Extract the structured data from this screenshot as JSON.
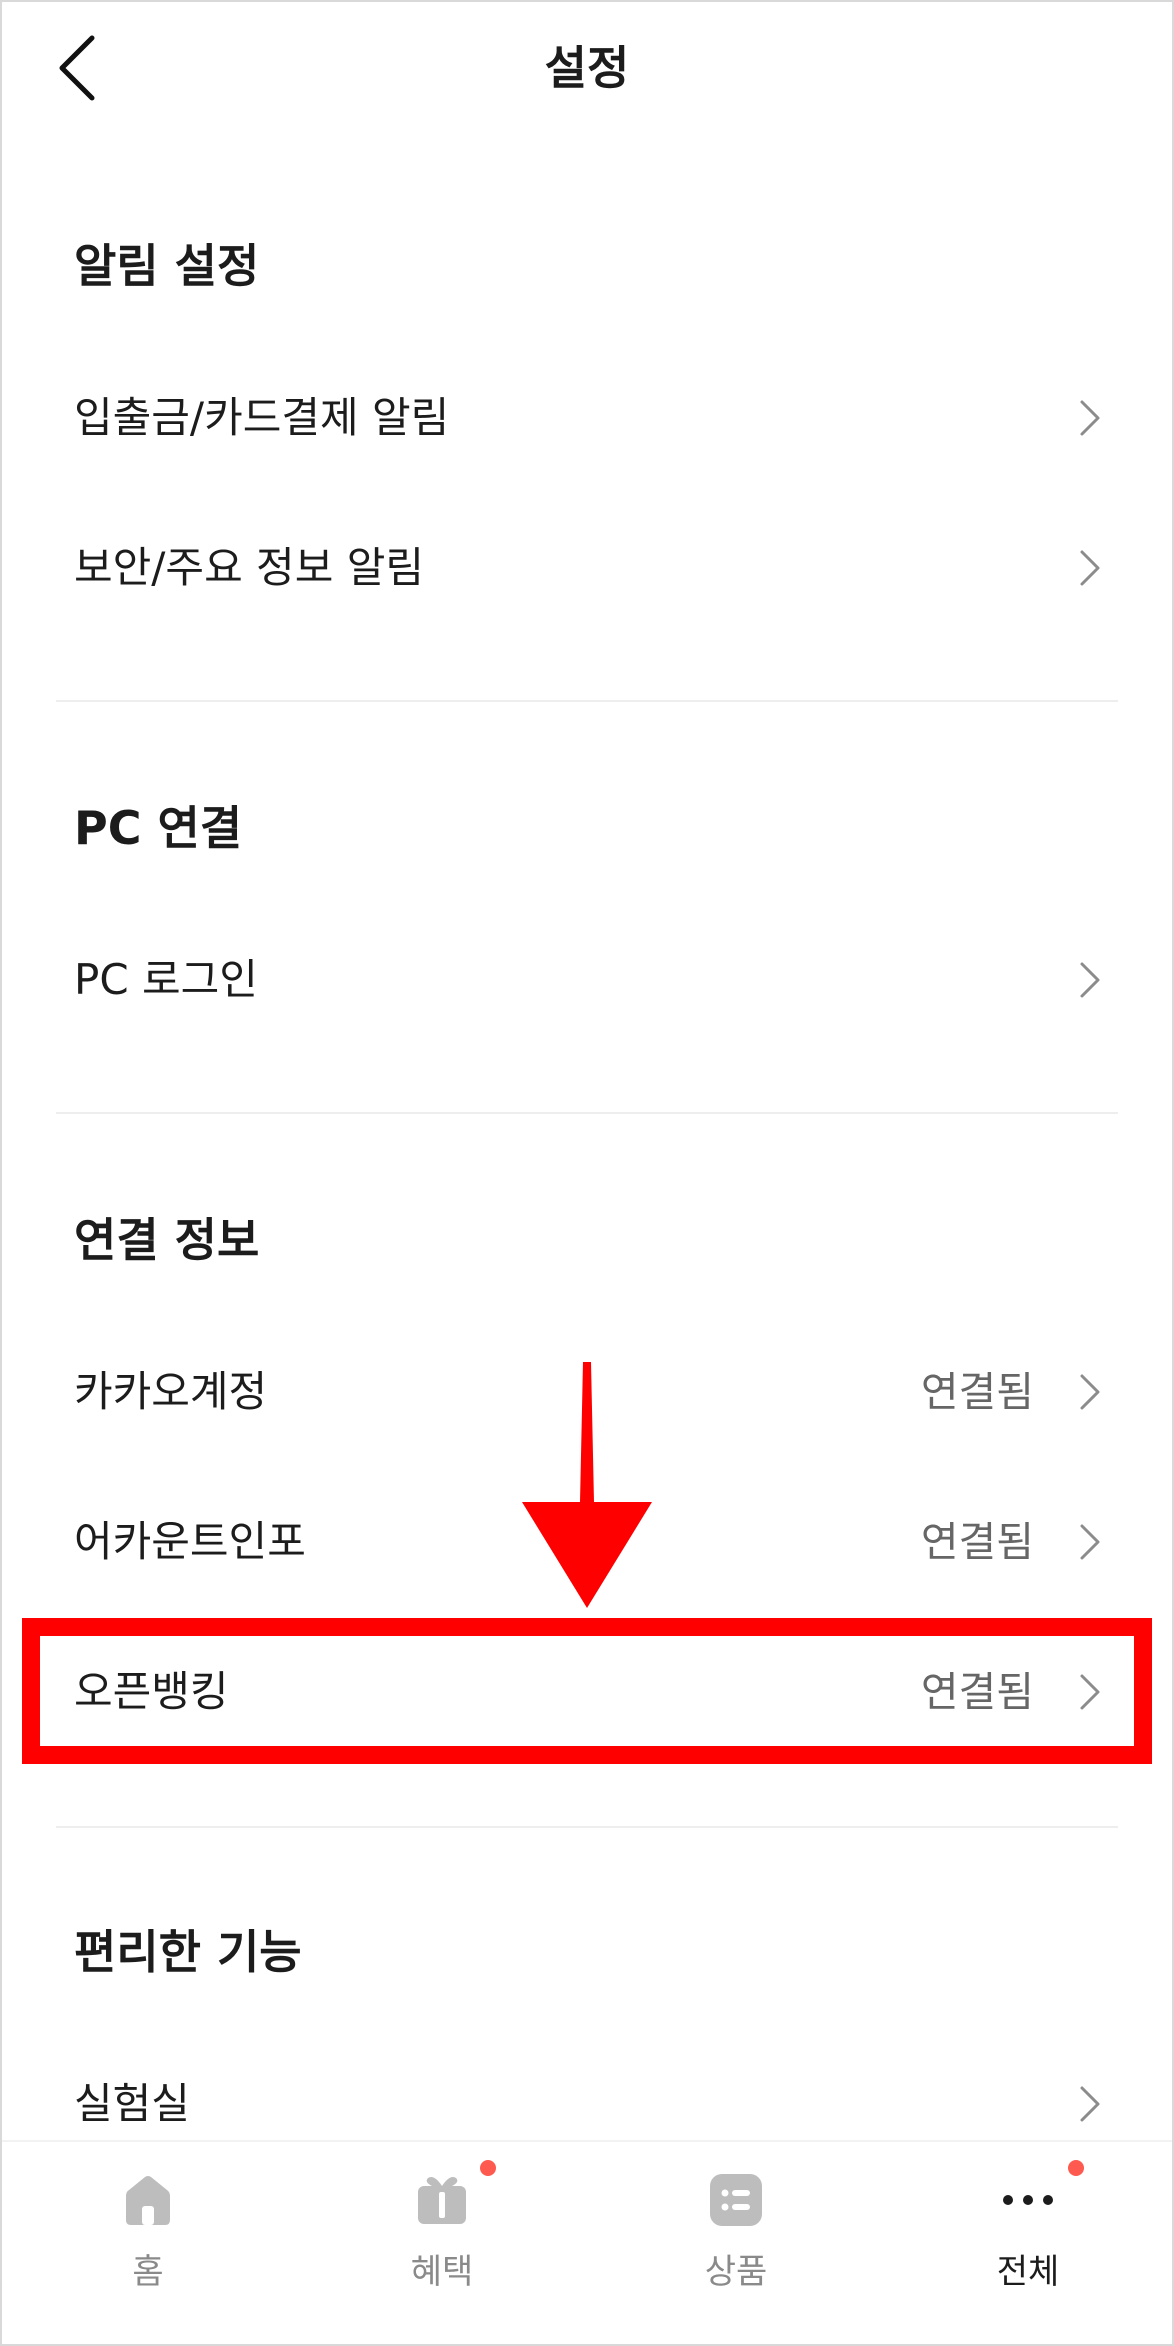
{
  "header": {
    "title": "설정"
  },
  "sections": [
    {
      "title": "알림 설정",
      "items": [
        {
          "label": "입출금/카드결제 알림",
          "status": ""
        },
        {
          "label": "보안/주요 정보 알림",
          "status": ""
        }
      ]
    },
    {
      "title": "PC 연결",
      "items": [
        {
          "label": "PC 로그인",
          "status": ""
        }
      ]
    },
    {
      "title": "연결 정보",
      "items": [
        {
          "label": "카카오계정",
          "status": "연결됨"
        },
        {
          "label": "어카운트인포",
          "status": "연결됨"
        },
        {
          "label": "오픈뱅킹",
          "status": "연결됨"
        }
      ]
    },
    {
      "title": "편리한 기능",
      "items": [
        {
          "label": "실험실",
          "status": ""
        }
      ]
    }
  ],
  "tabbar": {
    "tabs": [
      {
        "label": "홈",
        "icon": "home-icon",
        "active": false,
        "badge": false
      },
      {
        "label": "혜택",
        "icon": "gift-icon",
        "active": false,
        "badge": true
      },
      {
        "label": "상품",
        "icon": "list-icon",
        "active": false,
        "badge": false
      },
      {
        "label": "전체",
        "icon": "more-icon",
        "active": true,
        "badge": true
      }
    ]
  },
  "colors": {
    "highlight": "#ff0000",
    "badge": "#ff5a4f",
    "icon_gray": "#bdbdbd"
  }
}
